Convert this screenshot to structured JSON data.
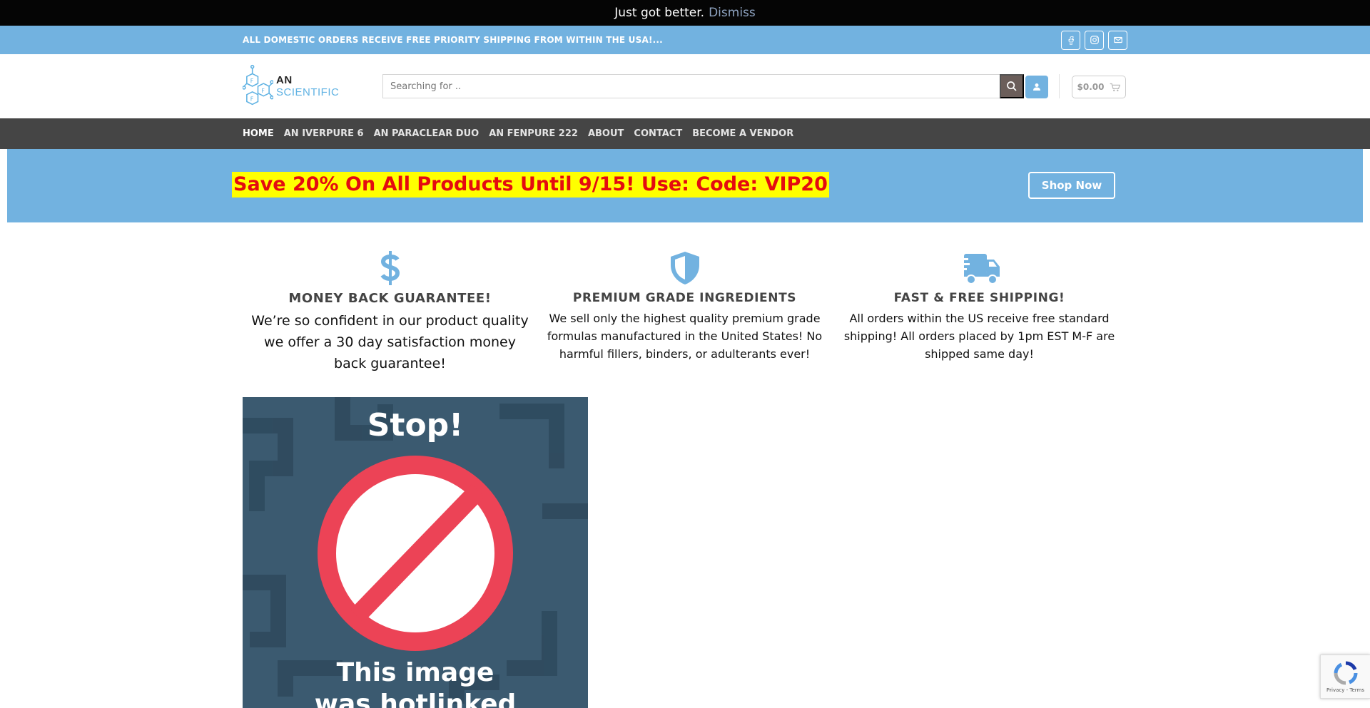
{
  "notice": {
    "text": "Just got better.",
    "dismiss": "Dismiss"
  },
  "topbar": {
    "shipping_message": "ALL DOMESTIC ORDERS RECEIVE FREE PRIORITY SHIPPING FROM WITHIN THE USA!...",
    "social": [
      {
        "icon": "facebook-icon",
        "glyph": "f"
      },
      {
        "icon": "instagram-icon",
        "glyph": "◎"
      },
      {
        "icon": "email-icon",
        "glyph": "✉"
      }
    ]
  },
  "header": {
    "logo_an": "AN",
    "logo_scientific": "SCIENTIFIC",
    "search_placeholder": "Searching for ..",
    "cart_total": "$0.00"
  },
  "nav": {
    "items": [
      "HOME",
      "AN IVERPURE 6",
      "AN PARACLEAR DUO",
      "AN FENPURE 222",
      "ABOUT",
      "CONTACT",
      "BECOME A VENDOR"
    ]
  },
  "promo": {
    "text": "Save 20% On All Products Until 9/15! Use: Code: VIP20",
    "button": "Shop Now"
  },
  "features": [
    {
      "icon": "dollar-icon",
      "title": "MONEY BACK GUARANTEE!",
      "text": "We’re so confident in our product quality we offer a 30 day satisfaction money back guarantee!"
    },
    {
      "icon": "shield-icon",
      "title": "PREMIUM GRADE INGREDIENTS",
      "text": "We sell only the highest quality premium grade formulas manufactured in the United States! No harmful fillers, binders, or adulterants ever!"
    },
    {
      "icon": "truck-icon",
      "title": "FAST & FREE SHIPPING!",
      "text": "All orders within the US receive free standard shipping! All orders placed by 1pm EST M-F are shipped same day!"
    }
  ],
  "hotlink_image": {
    "line_top": "Stop!",
    "line_1": "This image",
    "line_2": "was hotlinked"
  },
  "recaptcha": {
    "links": "Privacy - Terms"
  },
  "colors": {
    "accent": "#72b2e0",
    "nav_bg": "#454545",
    "promo_text": "#e40b10",
    "highlight": "#ffff00"
  }
}
